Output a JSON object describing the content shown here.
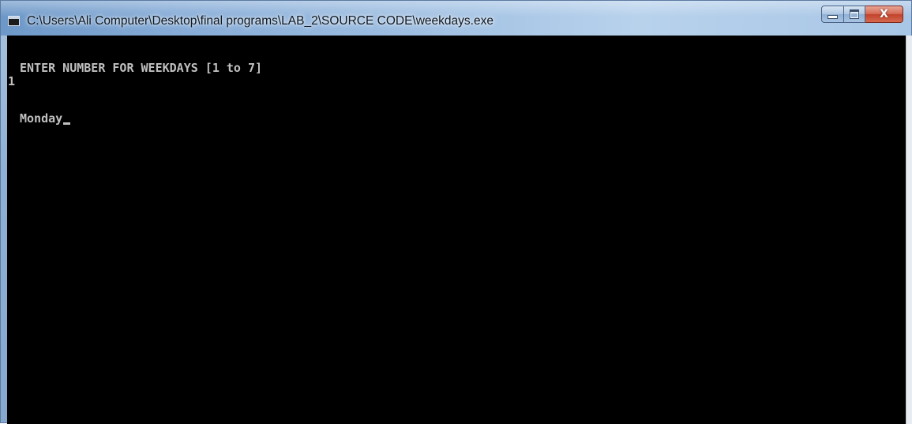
{
  "window": {
    "title": "C:\\Users\\Ali Computer\\Desktop\\final programs\\LAB_2\\SOURCE CODE\\weekdays.exe",
    "controls": {
      "minimize_icon": "minimize-icon",
      "maximize_icon": "maximize-icon",
      "close_icon": "close-icon",
      "close_glyph": "X"
    }
  },
  "console": {
    "background": "#000000",
    "text_color": "#c0c0c0",
    "lines": [
      "ENTER NUMBER FOR WEEKDAYS [1 to 7]",
      "1",
      "Monday"
    ]
  }
}
